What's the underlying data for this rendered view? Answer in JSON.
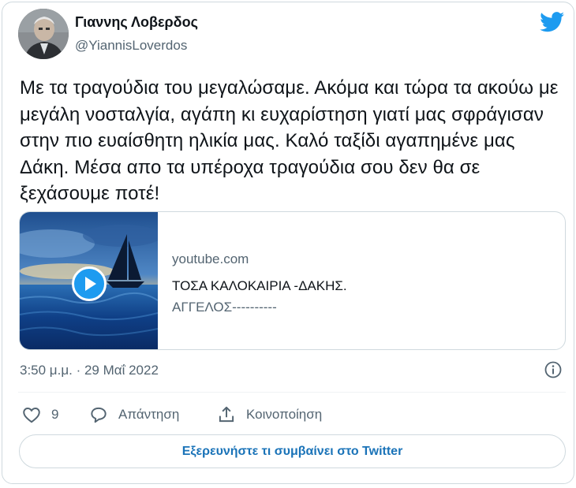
{
  "author": {
    "name": "Γιαννης Λοβερδος",
    "handle": "@YiannisLoverdos"
  },
  "tweet": {
    "text": "Με τα τραγούδια του μεγαλώσαμε. Ακόμα και τώρα τα ακούω με μεγάλη νοσταλγία, αγάπη κι ευχαρίστηση γιατί μας σφράγισαν στην πιο ευαίσθητη ηλικία μας. Καλό ταξίδι αγαπημένε μας Δάκη. Μέσα απο τα υπέροχα τραγούδια σου δεν θα σε ξεχάσουμε ποτέ!",
    "timestamp": "3:50 μ.μ. · 29 Μαΐ 2022"
  },
  "link_card": {
    "domain": "youtube.com",
    "title": "ΤΟΣΑ ΚΑΛΟΚΑΙΡΙΑ -ΔΑΚΗΣ.",
    "description": "ΑΓΓΕΛΟΣ----------",
    "thumbnail_icon": "sailboat-sunset-thumbnail",
    "play_icon": "play-icon"
  },
  "actions": {
    "like_count": "9",
    "reply_label": "Απάντηση",
    "share_label": "Κοινοποίηση"
  },
  "explore_button": {
    "label": "Εξερευνήστε τι συμβαίνει στο Twitter"
  },
  "colors": {
    "twitter_blue": "#1d9bf0",
    "link_blue": "#1a73b8",
    "secondary_text": "#536471",
    "border": "#cfd9de"
  }
}
